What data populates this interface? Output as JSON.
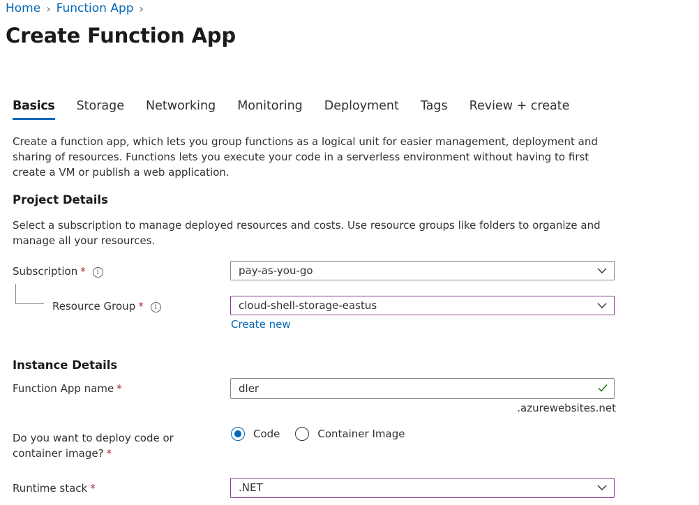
{
  "breadcrumb": {
    "home": "Home",
    "function_app": "Function App"
  },
  "page": {
    "title": "Create Function App",
    "more": "···"
  },
  "tabs": [
    {
      "label": "Basics",
      "active": true
    },
    {
      "label": "Storage"
    },
    {
      "label": "Networking"
    },
    {
      "label": "Monitoring"
    },
    {
      "label": "Deployment"
    },
    {
      "label": "Tags"
    },
    {
      "label": "Review + create"
    }
  ],
  "intro": "Create a function app, which lets you group functions as a logical unit for easier management, deployment and sharing of resources. Functions lets you execute your code in a serverless environment without having to first create a VM or publish a web application.",
  "project": {
    "heading": "Project Details",
    "description": "Select a subscription to manage deployed resources and costs. Use resource groups like folders to organize and manage all your resources.",
    "subscription_label": "Subscription",
    "subscription_value": "pay-as-you-go",
    "resource_group_label": "Resource Group",
    "resource_group_value": "cloud-shell-storage-eastus",
    "create_new": "Create new"
  },
  "instance": {
    "heading": "Instance Details",
    "name_label": "Function App name",
    "name_value": "dler",
    "name_suffix": ".azurewebsites.net",
    "deploy_label": "Do you want to deploy code or container image?",
    "deploy_options": [
      "Code",
      "Container Image"
    ],
    "runtime_label": "Runtime stack",
    "runtime_value": ".NET"
  },
  "common": {
    "required": "*",
    "info": "i"
  },
  "colors": {
    "accent": "#0067b8",
    "required": "#a4262c",
    "valid": "#107c10",
    "focus": "#8a3c8f"
  },
  "icons": {
    "chevron": "chevron-down-icon",
    "info": "info-icon",
    "valid": "checkmark-icon"
  }
}
